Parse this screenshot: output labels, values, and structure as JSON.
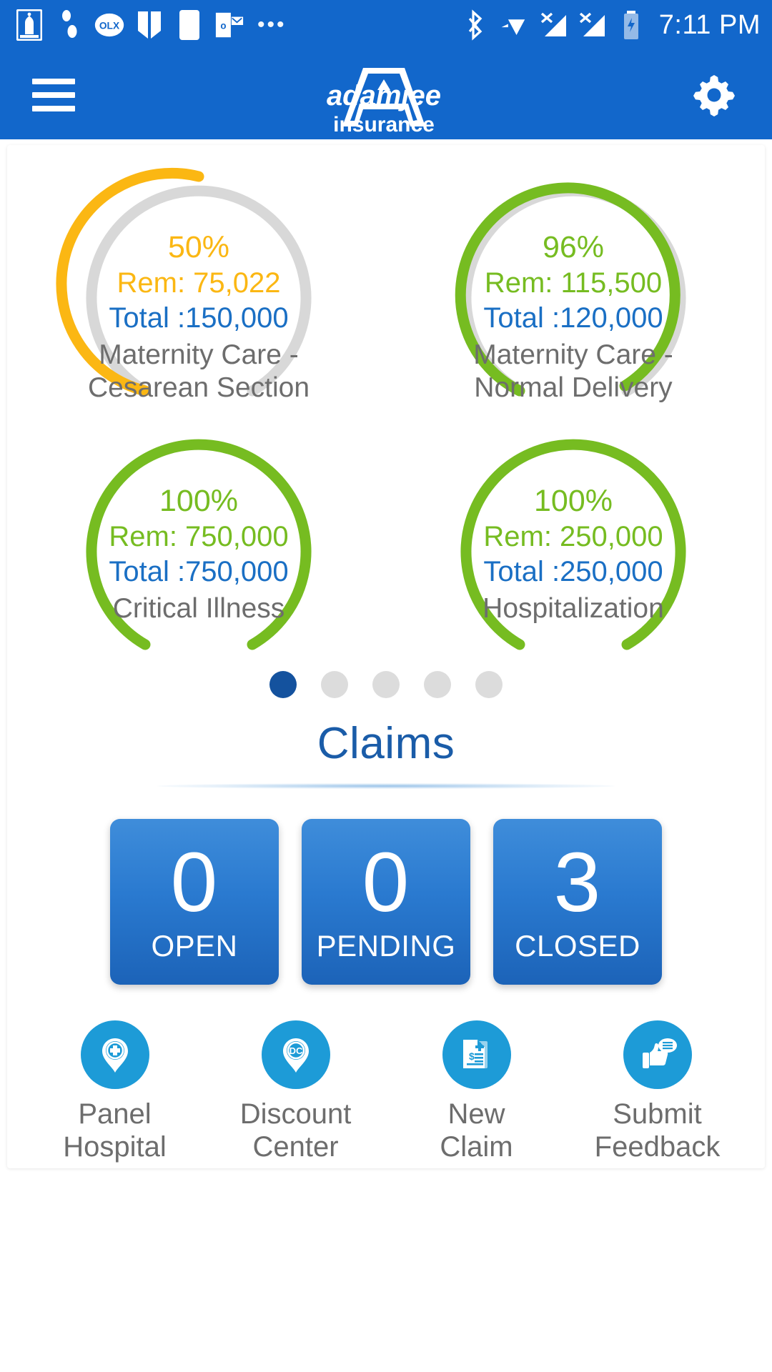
{
  "statusbar": {
    "icons": [
      "mosque-app-icon",
      "footsteps-app-icon",
      "olx-app-icon",
      "book-app-icon",
      "note-app-icon",
      "outlook-app-icon"
    ],
    "olx_label": "OLX",
    "outlook_label": "o",
    "overflow": "•••",
    "right_icons": [
      "bluetooth-icon",
      "wifi-icon",
      "signal-1-none-icon",
      "signal-2-none-icon",
      "battery-charging-icon"
    ],
    "time": "7:11 PM"
  },
  "appbar": {
    "menu_label": "menu-icon",
    "brand_name": "adamjee",
    "brand_sub": "insurance",
    "settings_label": "gear-icon"
  },
  "chart_data": {
    "type": "gauge",
    "title": "Benefit Utilization Gauges",
    "gauges": [
      {
        "percent": 50,
        "percent_label": "50%",
        "remaining_label": "Rem: 75,022",
        "remaining_value": 75022,
        "total_label": "Total :150,000",
        "total_value": 150000,
        "name": "Maternity Care -\nCesarean Section",
        "color": "#fbb713",
        "track_color": "#d8d8d8"
      },
      {
        "percent": 96,
        "percent_label": "96%",
        "remaining_label": "Rem: 115,500",
        "remaining_value": 115500,
        "total_label": "Total :120,000",
        "total_value": 120000,
        "name": "Maternity Care -\nNormal Delivery",
        "color": "#76bc21",
        "track_color": "#d8d8d8"
      },
      {
        "percent": 100,
        "percent_label": "100%",
        "remaining_label": "Rem: 750,000",
        "remaining_value": 750000,
        "total_label": "Total :750,000",
        "total_value": 750000,
        "name": "Critical Illness",
        "color": "#76bc21",
        "track_color": "#d8d8d8"
      },
      {
        "percent": 100,
        "percent_label": "100%",
        "remaining_label": "Rem: 250,000",
        "remaining_value": 250000,
        "total_label": "Total :250,000",
        "total_value": 250000,
        "name": "Hospitalization",
        "color": "#76bc21",
        "track_color": "#d8d8d8"
      }
    ]
  },
  "pager": {
    "count": 5,
    "active_index": 0,
    "active_color": "#14529e",
    "inactive_color": "#dcdcdc"
  },
  "claims": {
    "title": "Claims",
    "cards": [
      {
        "count": "0",
        "label": "OPEN"
      },
      {
        "count": "0",
        "label": "PENDING"
      },
      {
        "count": "3",
        "label": "CLOSED"
      }
    ]
  },
  "actions": [
    {
      "icon": "hospital-pin-icon",
      "label": "Panel\nHospital"
    },
    {
      "icon": "discount-center-pin-icon",
      "label": "Discount\nCenter",
      "badge": "DC"
    },
    {
      "icon": "new-claim-document-icon",
      "label": "New\nClaim"
    },
    {
      "icon": "thumbs-up-feedback-icon",
      "label": "Submit\nFeedback"
    }
  ],
  "theme": {
    "primary": "#1267cb",
    "accent_blue": "#1d9bd7",
    "green": "#76bc21",
    "amber": "#fbb713",
    "total_blue": "#1a6fc4"
  }
}
